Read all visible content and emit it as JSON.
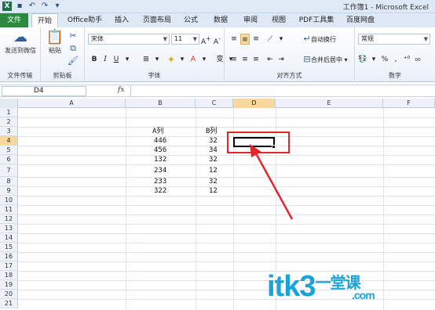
{
  "window": {
    "title": "工作簿1 - Microsoft Excel"
  },
  "ribbon_tabs": [
    {
      "label": "文件"
    },
    {
      "label": "开始"
    },
    {
      "label": "Office助手"
    },
    {
      "label": "插入"
    },
    {
      "label": "页面布局"
    },
    {
      "label": "公式"
    },
    {
      "label": "数据"
    },
    {
      "label": "审阅"
    },
    {
      "label": "视图"
    },
    {
      "label": "PDF工具集"
    },
    {
      "label": "百度网盘"
    }
  ],
  "ribbon": {
    "send_label": "发送到微信",
    "paste_label": "粘贴",
    "font_name": "宋体",
    "font_size": "11",
    "wrap_text_label": "自动换行",
    "merge_label": "合并后居中",
    "number_format": "常规",
    "groups": {
      "file_transfer": "文件传输",
      "clipboard": "剪贴板",
      "font": "字体",
      "alignment": "对齐方式",
      "number": "数字"
    }
  },
  "formula_bar": {
    "name_box": "D4",
    "fx_label": "fx",
    "content": ""
  },
  "columns": [
    "A",
    "B",
    "C",
    "D",
    "E",
    "F"
  ],
  "selected_column": "D",
  "rows": [
    "1",
    "2",
    "3",
    "4",
    "5",
    "6",
    "7",
    "8",
    "9",
    "10",
    "11",
    "12",
    "13",
    "14",
    "15",
    "16",
    "17",
    "18",
    "19",
    "20",
    "21"
  ],
  "selected_row": "4",
  "sheet": {
    "header": {
      "B": "A列",
      "C": "B列"
    },
    "data": [
      {
        "B": "446",
        "C": "32"
      },
      {
        "B": "456",
        "C": "34"
      },
      {
        "B": "132",
        "C": "32"
      },
      {
        "B": "234",
        "C": "12"
      },
      {
        "B": "233",
        "C": "32"
      },
      {
        "B": "322",
        "C": "12"
      }
    ]
  },
  "watermark": {
    "text": "itk3",
    "suffix": "一堂课",
    "domain": ".com"
  },
  "colors": {
    "file_tab": "#2a8a3e",
    "annotation": "#e3262a",
    "selection_header": "#f7d79a",
    "watermark": "#1aa3d6"
  }
}
